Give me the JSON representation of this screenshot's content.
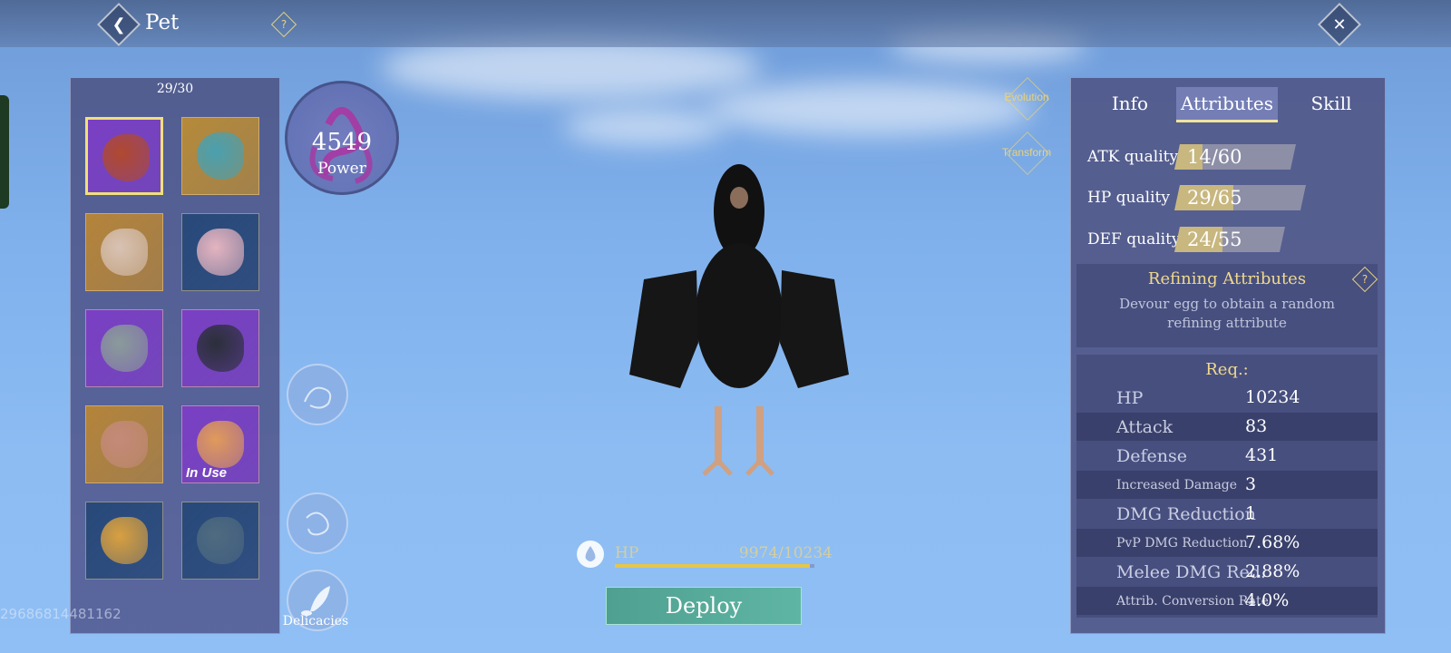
{
  "header": {
    "title": "Pet",
    "back_icon": "back-arrow-icon",
    "close_icon": "close-x-icon",
    "help_icon": "help-question-icon"
  },
  "pet_list": {
    "count": "29/30",
    "pets": [
      {
        "name": "phoenix-bird",
        "bg": "#7a3fc4",
        "art": "#b0492f",
        "selected": true,
        "in_use": ""
      },
      {
        "name": "azure-dragon",
        "bg": "#b58a3a",
        "art": "#4aa0b0",
        "selected": false,
        "in_use": ""
      },
      {
        "name": "mantis",
        "bg": "#b4843a",
        "art": "#d8c2b4",
        "selected": false,
        "in_use": ""
      },
      {
        "name": "pink-bird",
        "bg": "#27497a",
        "art": "#e4b4c0",
        "selected": false,
        "in_use": ""
      },
      {
        "name": "lizard",
        "bg": "#7a3fc4",
        "art": "#8a9b9a",
        "selected": false,
        "in_use": ""
      },
      {
        "name": "penguin",
        "bg": "#7a3fc4",
        "art": "#2b2f3a",
        "selected": false,
        "in_use": ""
      },
      {
        "name": "pterosaur",
        "bg": "#b4843a",
        "art": "#c48a7a",
        "selected": false,
        "in_use": ""
      },
      {
        "name": "fox",
        "bg": "#7a3fc4",
        "art": "#e09a5a",
        "selected": false,
        "in_use": "In Use"
      },
      {
        "name": "golden-fish",
        "bg": "#27497a",
        "art": "#d8a040",
        "selected": false,
        "in_use": ""
      },
      {
        "name": "blue-raptor",
        "bg": "#27497a",
        "art": "#4f6b80",
        "selected": false,
        "in_use": ""
      }
    ]
  },
  "uid": "29686814481162",
  "power": {
    "value": "4549",
    "label": "Power"
  },
  "side_buttons": {
    "delicacies_label": "Delicacies"
  },
  "evolution": {
    "evolution_label": "Evolution",
    "transform_label": "Transform"
  },
  "hp": {
    "label": "HP",
    "value": "9974/10234",
    "fraction": 0.975
  },
  "deploy_label": "Deploy",
  "tabs": [
    {
      "label": "Info",
      "active": false
    },
    {
      "label": "Attributes",
      "active": true
    },
    {
      "label": "Skill",
      "active": false
    }
  ],
  "qualities": [
    {
      "label": "ATK quality",
      "value": "14/60",
      "fraction": 0.233
    },
    {
      "label": "HP quality",
      "value": "29/65",
      "fraction": 0.446
    },
    {
      "label": "DEF quality",
      "value": "24/55",
      "fraction": 0.436
    }
  ],
  "refining": {
    "title": "Refining Attributes",
    "desc": "Devour egg to obtain a random refining attribute"
  },
  "requirements": {
    "title": "Req.:",
    "rows": [
      {
        "label": "HP",
        "value": "10234",
        "small": false
      },
      {
        "label": "Attack",
        "value": "83",
        "small": false
      },
      {
        "label": "Defense",
        "value": "431",
        "small": false
      },
      {
        "label": "Increased Damage",
        "value": "3",
        "small": true
      },
      {
        "label": "DMG Reduction",
        "value": "1",
        "small": false
      },
      {
        "label": "PvP DMG Reduction",
        "value": "7.68%",
        "small": true
      },
      {
        "label": "Melee DMG Red.",
        "value": "2.88%",
        "small": false
      },
      {
        "label": "Attrib. Conversion Rate",
        "value": "4.0%",
        "small": true
      }
    ]
  }
}
